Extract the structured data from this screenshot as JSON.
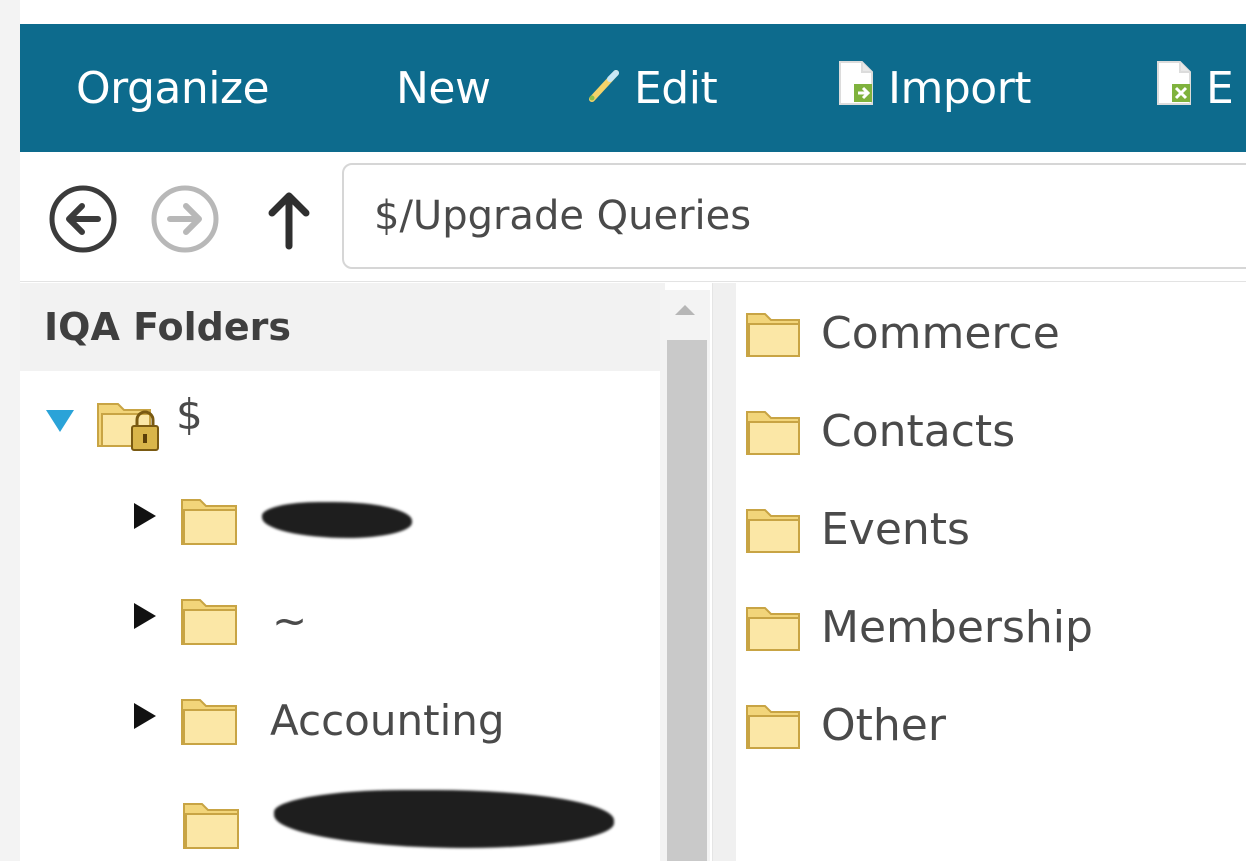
{
  "toolbar": {
    "organize_label": "Organize",
    "new_label": "New",
    "edit_label": "Edit",
    "import_label": "Import",
    "export_label": "E",
    "icons": {
      "edit": "pencil-icon",
      "import": "import-file-icon",
      "export": "export-file-icon"
    },
    "background": "#0d6b8d"
  },
  "navigation": {
    "back_icon": "back-arrow-circle-icon",
    "forward_icon": "forward-arrow-circle-icon",
    "up_icon": "up-arrow-icon",
    "address": "$/Upgrade Queries"
  },
  "tree": {
    "title": "IQA Folders",
    "root": {
      "label": "$",
      "expanded": true,
      "icon": "locked-folder-icon"
    },
    "items": [
      {
        "label": "",
        "redacted": true,
        "icon": "folder-icon"
      },
      {
        "label": "~",
        "redacted": false,
        "icon": "folder-icon"
      },
      {
        "label": "Accounting",
        "redacted": false,
        "icon": "folder-icon"
      },
      {
        "label": "",
        "redacted": true,
        "icon": "folder-icon"
      }
    ]
  },
  "contents": {
    "items": [
      {
        "label": "Commerce",
        "icon": "folder-icon"
      },
      {
        "label": "Contacts",
        "icon": "folder-icon"
      },
      {
        "label": "Events",
        "icon": "folder-icon"
      },
      {
        "label": "Membership",
        "icon": "folder-icon"
      },
      {
        "label": "Other",
        "icon": "folder-icon"
      }
    ]
  },
  "colors": {
    "accent": "#0d6b8d",
    "expand_arrow": "#2aa3d8",
    "folder": "#f7df8f"
  }
}
